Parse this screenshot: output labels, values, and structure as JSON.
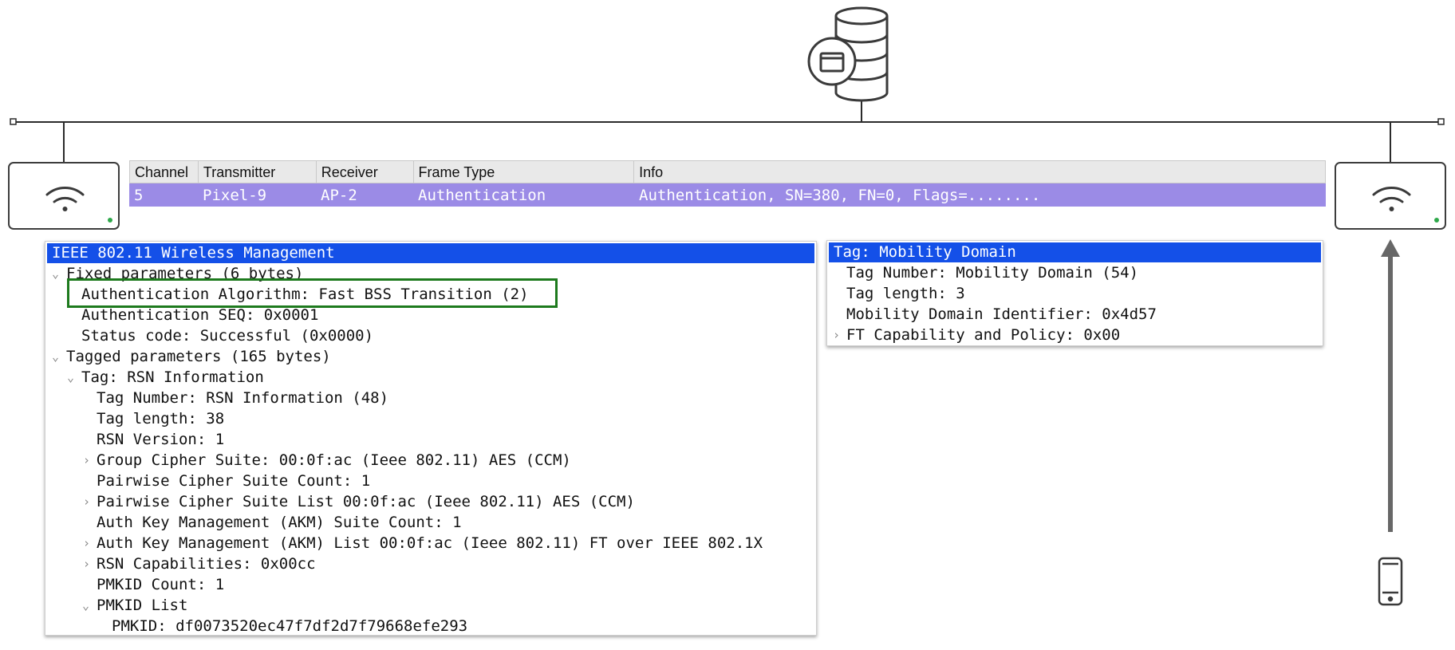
{
  "packet_list": {
    "headers": [
      "Channel",
      "Transmitter",
      "Receiver",
      "Frame Type",
      "Info"
    ],
    "rows": [
      {
        "channel": "5",
        "transmitter": "Pixel-9",
        "receiver": "AP-2",
        "frame_type": "Authentication",
        "info": "Authentication, SN=380, FN=0, Flags=........"
      }
    ]
  },
  "left_pane": {
    "title": "IEEE 802.11 Wireless Management",
    "lines": [
      "Fixed parameters (6 bytes)",
      "Authentication Algorithm: Fast BSS Transition (2)",
      "Authentication SEQ: 0x0001",
      "Status code: Successful (0x0000)",
      "Tagged parameters (165 bytes)",
      "Tag: RSN Information",
      "Tag Number: RSN Information (48)",
      "Tag length: 38",
      "RSN Version: 1",
      "Group Cipher Suite: 00:0f:ac (Ieee 802.11) AES (CCM)",
      "Pairwise Cipher Suite Count: 1",
      "Pairwise Cipher Suite List 00:0f:ac (Ieee 802.11) AES (CCM)",
      "Auth Key Management (AKM) Suite Count: 1",
      "Auth Key Management (AKM) List 00:0f:ac (Ieee 802.11) FT over IEEE 802.1X",
      "RSN Capabilities: 0x00cc",
      "PMKID Count: 1",
      "PMKID List",
      "PMKID: df0073520ec47f7df2d7f79668efe293"
    ]
  },
  "right_pane": {
    "title": "Tag: Mobility Domain",
    "lines": [
      "Tag Number: Mobility Domain (54)",
      "Tag length: 3",
      "Mobility Domain Identifier: 0x4d57",
      "FT Capability and Policy: 0x00"
    ]
  },
  "icons": {
    "server": "database-server-icon",
    "ap": "wifi-icon",
    "client": "smartphone-icon",
    "expanded": "chevron-down-icon",
    "collapsed": "chevron-right-icon"
  },
  "colors": {
    "selected_row": "#9b8be6",
    "pane_header": "#1450e8",
    "highlight": "#1d7a1d",
    "ap_led": "#2ea84a"
  }
}
